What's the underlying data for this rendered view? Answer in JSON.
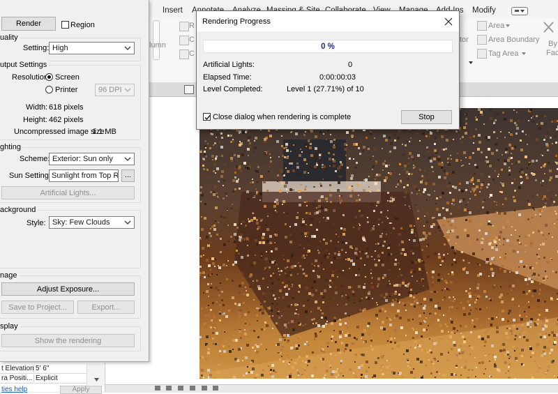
{
  "ribbon": {
    "tabs": [
      "Insert",
      "Annotate",
      "Analyze",
      "Massing & Site",
      "Collaborate",
      "View",
      "Manage",
      "Add-Ins",
      "Modify"
    ],
    "panel_items": {
      "column": "lumn",
      "area": "Area",
      "area_boundary": "Area Boundary",
      "tag_area": "Tag Area",
      "by_face_1": "By",
      "by_face_2": "Face",
      "r_fragment": "R",
      "c_fragment": "C",
      "c2_fragment": "C",
      "tor_fragment": "tor"
    }
  },
  "rendering_panel": {
    "render_button": "Render",
    "region_label": "Region",
    "region_checked": false,
    "quality": {
      "title": "uality",
      "setting_label": "Setting:",
      "setting_value": "High"
    },
    "output": {
      "title": "utput Settings",
      "resolution_label": "Resolution:",
      "screen_label": "Screen",
      "printer_label": "Printer",
      "selected": "Screen",
      "dpi_value": "96 DPI",
      "width_label": "Width:",
      "width_value": "618 pixels",
      "height_label": "Height:",
      "height_value": "462 pixels",
      "uncompressed_label": "Uncompressed image size:",
      "uncompressed_value": "1.1 MB"
    },
    "lighting": {
      "title": "ghting",
      "scheme_label": "Scheme:",
      "scheme_value": "Exterior: Sun only",
      "sun_label": "Sun Setting:",
      "sun_value": "Sunlight from Top Righ",
      "browse_label": "...",
      "artificial_lights_button": "Artificial Lights..."
    },
    "background": {
      "title": "ackground",
      "style_label": "Style:",
      "style_value": "Sky: Few Clouds"
    },
    "image": {
      "title": "nage",
      "adjust_exposure_button": "Adjust Exposure...",
      "save_to_project_button": "Save to Project...",
      "export_button": "Export..."
    },
    "display": {
      "title": "splay",
      "show_rendering_button": "Show the rendering"
    }
  },
  "properties": {
    "rows": [
      {
        "name": "t Elevation",
        "value": "5'  6\""
      },
      {
        "name": "ra Positi...",
        "value": "Explicit"
      }
    ],
    "help_link": "ties help",
    "apply_button": "Apply"
  },
  "progress_dialog": {
    "title": "Rendering Progress",
    "percent_text": "0 %",
    "percent_value": 0,
    "artificial_lights_label": "Artificial Lights:",
    "artificial_lights_value": "0",
    "elapsed_label": "Elapsed Time:",
    "elapsed_value": "0:00:00:03",
    "level_label": "Level Completed:",
    "level_value": "Level 1 (27.71%) of 10",
    "close_when_done_label": "Close dialog when rendering is complete",
    "close_when_done_checked": true,
    "stop_button": "Stop"
  },
  "colors": {
    "progress_text": "#1f2d86",
    "progress_fill": "#06b025",
    "panel_bg": "#f0f0f0"
  }
}
